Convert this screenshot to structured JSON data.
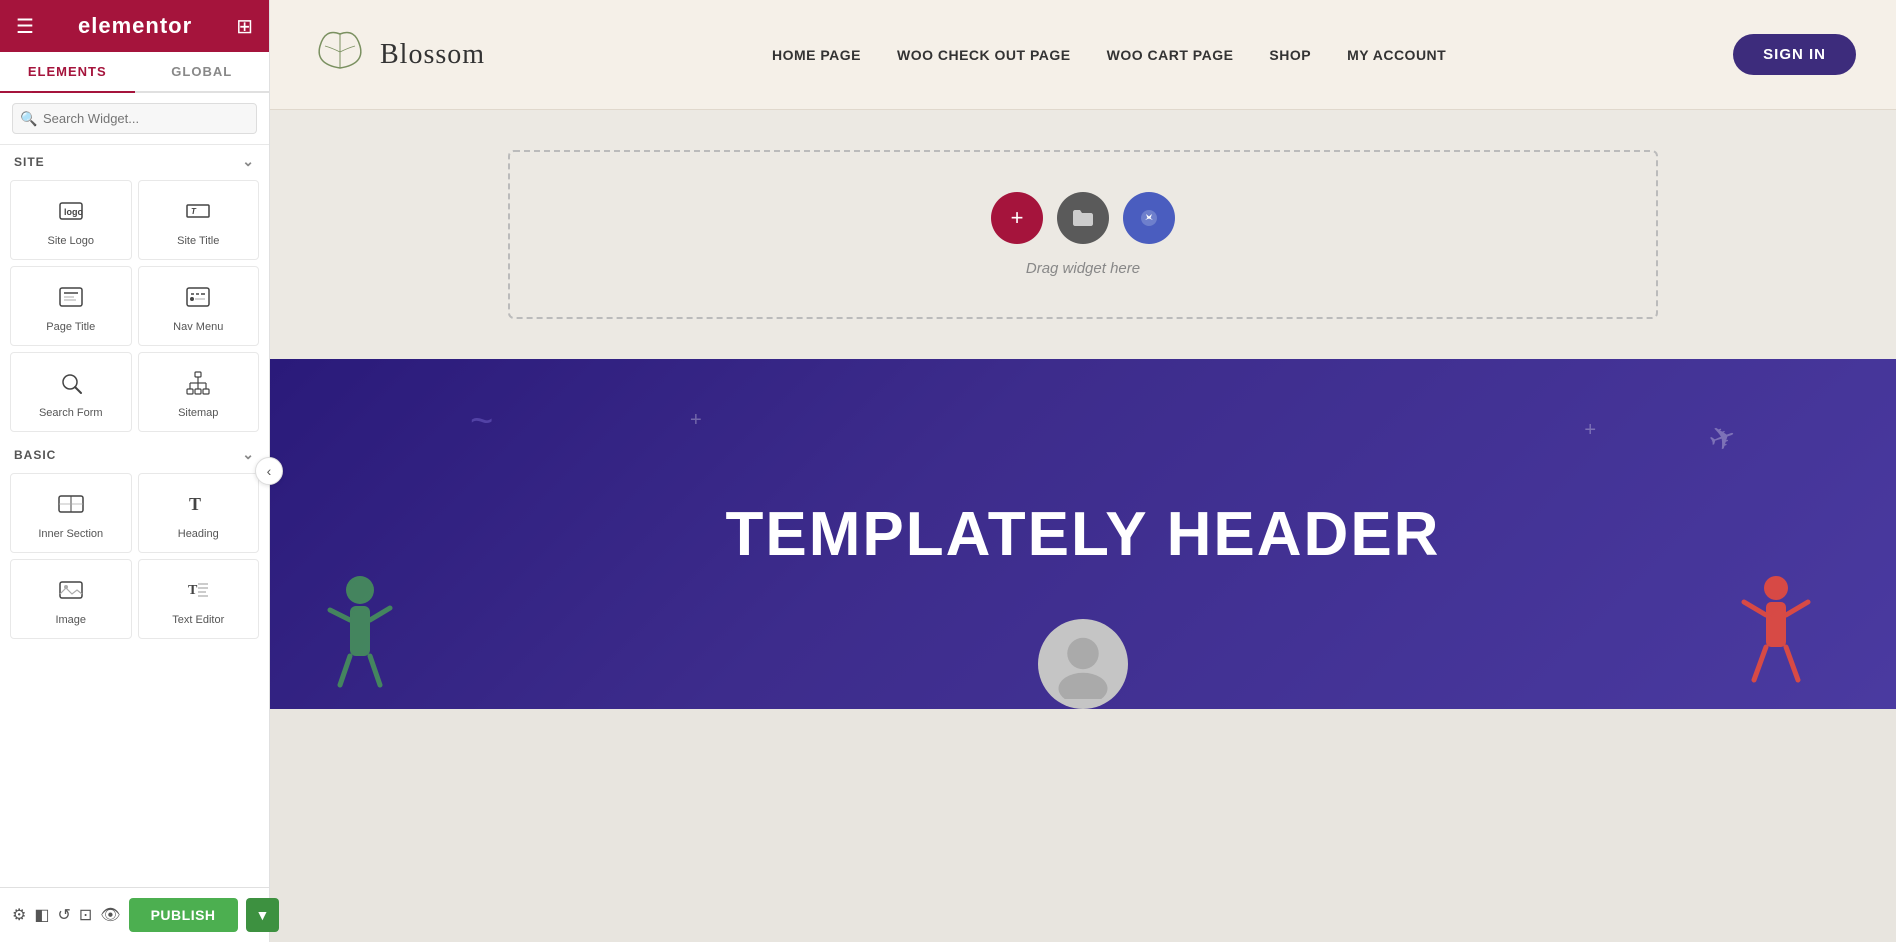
{
  "sidebar": {
    "logo": "elementor",
    "tabs": [
      {
        "id": "elements",
        "label": "ELEMENTS",
        "active": true
      },
      {
        "id": "global",
        "label": "GLOBAL",
        "active": false
      }
    ],
    "search_placeholder": "Search Widget...",
    "sections": [
      {
        "id": "site",
        "label": "SITE",
        "expanded": true,
        "widgets": [
          {
            "id": "site-logo",
            "label": "Site Logo",
            "icon": "logo"
          },
          {
            "id": "site-title",
            "label": "Site Title",
            "icon": "title"
          },
          {
            "id": "page-title",
            "label": "Page Title",
            "icon": "page-title"
          },
          {
            "id": "nav-menu",
            "label": "Nav Menu",
            "icon": "nav"
          },
          {
            "id": "search-form",
            "label": "Search Form",
            "icon": "search"
          },
          {
            "id": "sitemap",
            "label": "Sitemap",
            "icon": "sitemap"
          }
        ]
      },
      {
        "id": "basic",
        "label": "BASIC",
        "expanded": true,
        "widgets": [
          {
            "id": "inner-section",
            "label": "Inner Section",
            "icon": "inner-section"
          },
          {
            "id": "heading",
            "label": "Heading",
            "icon": "heading"
          },
          {
            "id": "image",
            "label": "Image",
            "icon": "image"
          },
          {
            "id": "text-editor",
            "label": "Text Editor",
            "icon": "text-editor"
          }
        ]
      }
    ],
    "bottom_icons": [
      "settings",
      "layers",
      "history",
      "responsive",
      "preview"
    ],
    "publish_label": "PUBLISH",
    "publish_arrow": "▼"
  },
  "preview": {
    "nav": {
      "logo_text": "Blossom",
      "logo_icon": "🌿",
      "menu_items": [
        {
          "id": "home",
          "label": "HOME PAGE"
        },
        {
          "id": "woo-checkout",
          "label": "WOO CHECK OUT PAGE"
        },
        {
          "id": "woo-cart",
          "label": "WOO CART PAGE"
        },
        {
          "id": "shop",
          "label": "SHOP"
        },
        {
          "id": "my-account",
          "label": "MY ACCOUNT"
        }
      ],
      "sign_in_label": "SIGN IN"
    },
    "drop_zone": {
      "text": "Drag widget here"
    },
    "promo": {
      "title": "TEMPLATELY HEADER"
    }
  },
  "icons": {
    "menu": "☰",
    "grid": "⊞",
    "search": "🔍",
    "chevron_down": "⌄",
    "chevron_left": "‹",
    "settings": "⚙",
    "layers": "◧",
    "history": "↺",
    "responsive": "⊡",
    "eye": "👁",
    "plus": "+",
    "folder": "🗂",
    "template": "★"
  }
}
